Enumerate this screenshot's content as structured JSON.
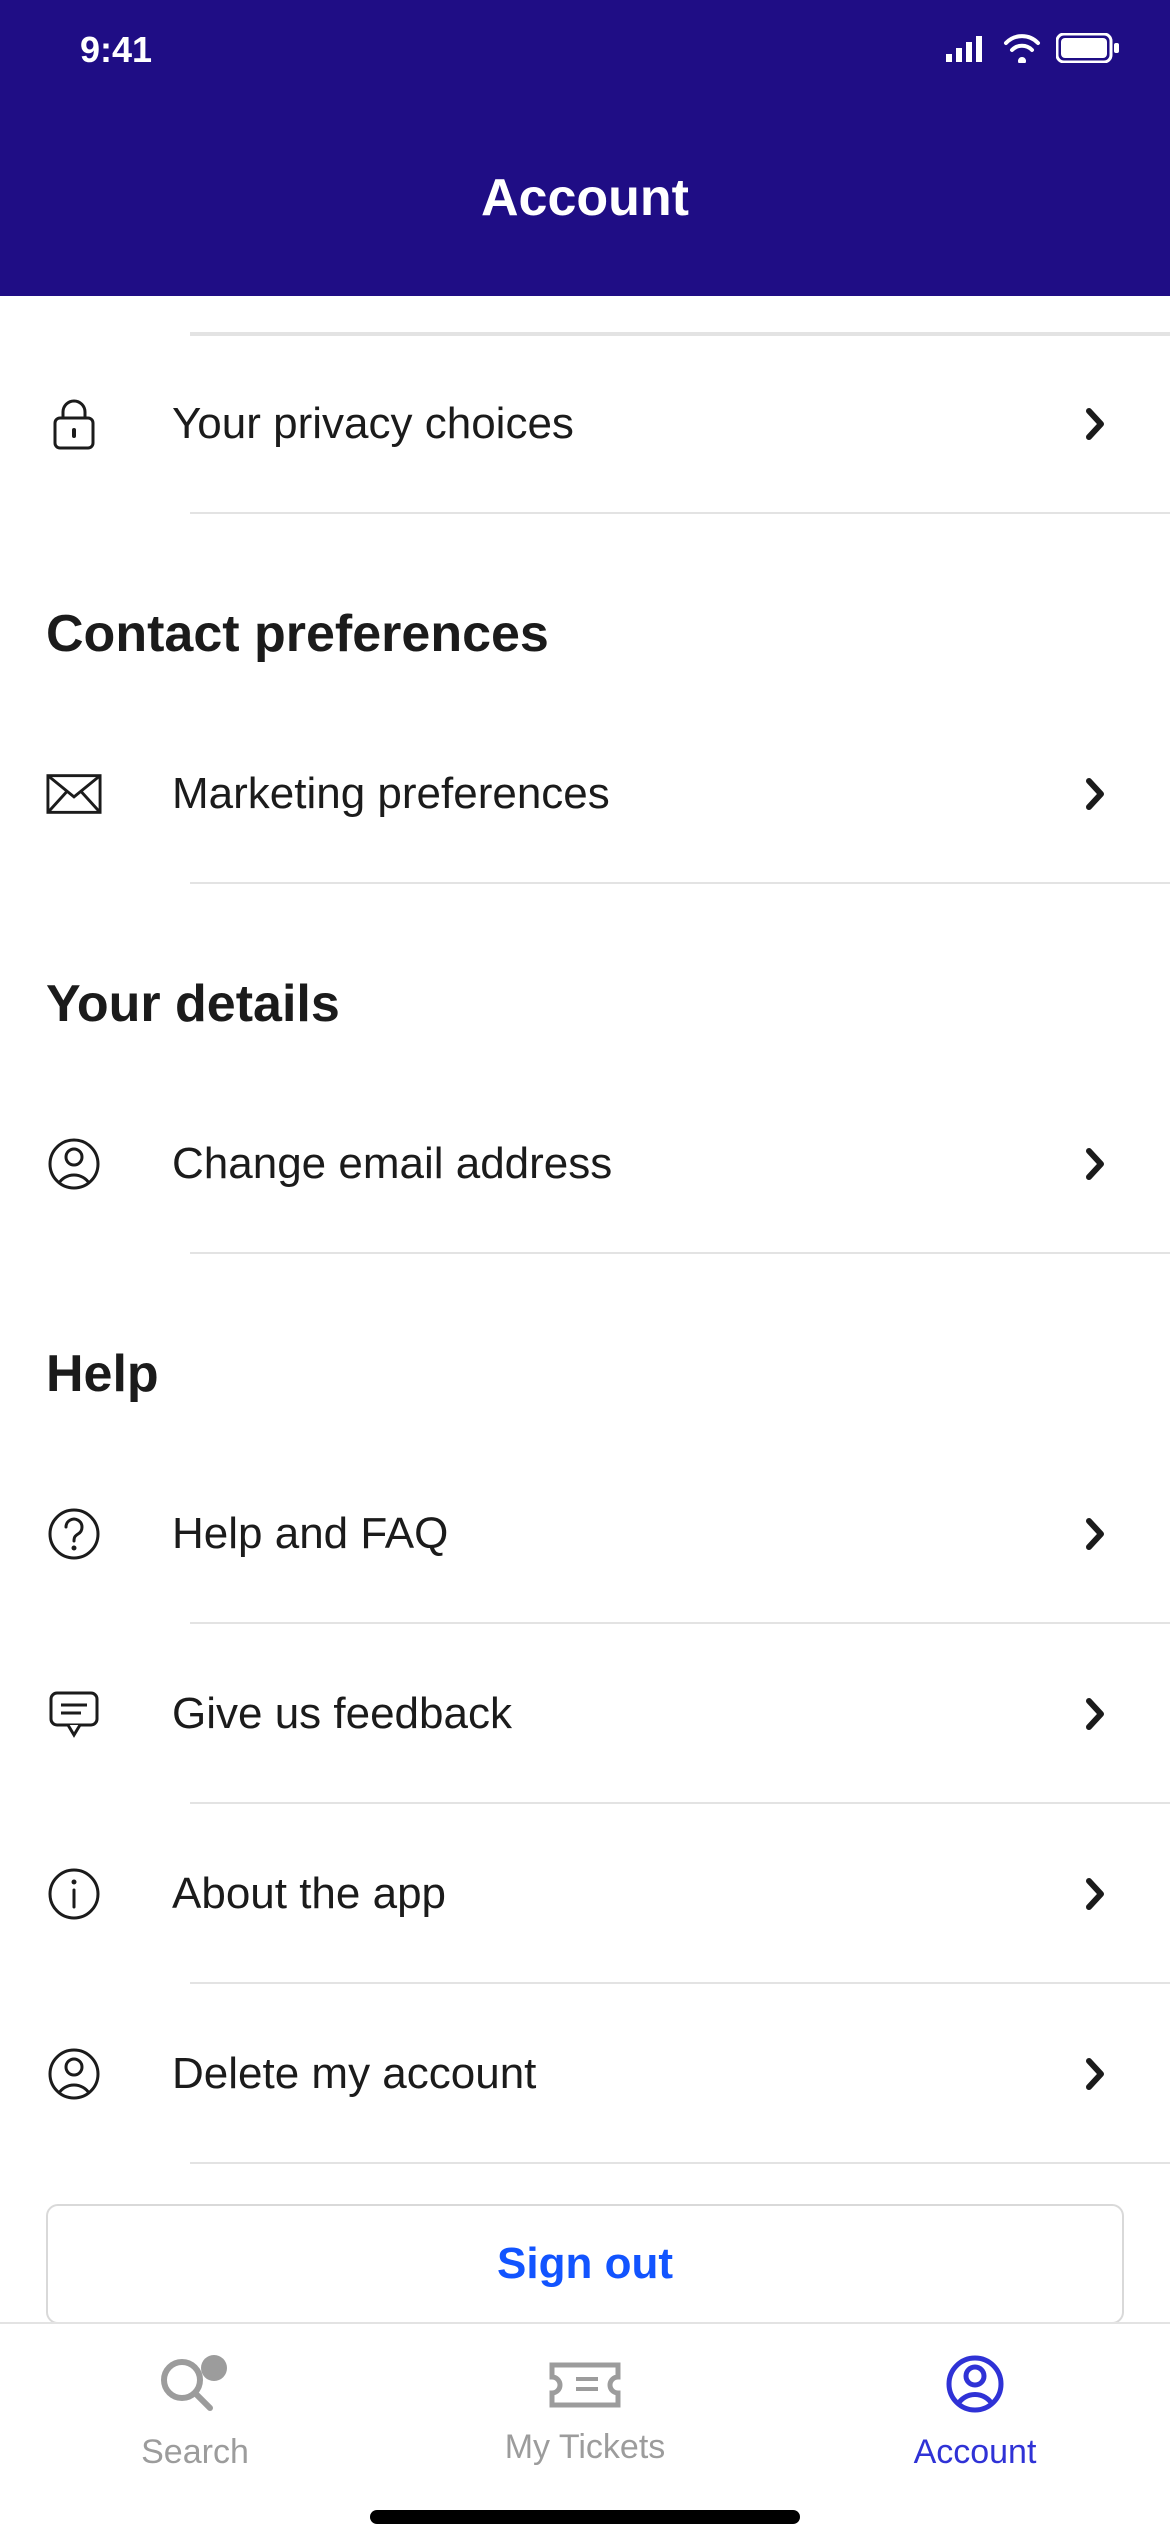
{
  "status": {
    "time": "9:41"
  },
  "header": {
    "title": "Account"
  },
  "rows": {
    "privacy": "Your privacy choices",
    "marketing": "Marketing preferences",
    "change_email": "Change email address",
    "help_faq": "Help and FAQ",
    "feedback": "Give us feedback",
    "about": "About the app",
    "delete": "Delete my account"
  },
  "sections": {
    "contact": "Contact preferences",
    "details": "Your details",
    "help": "Help"
  },
  "signout": "Sign out",
  "tabs": {
    "search": "Search",
    "tickets": "My Tickets",
    "account": "Account"
  }
}
